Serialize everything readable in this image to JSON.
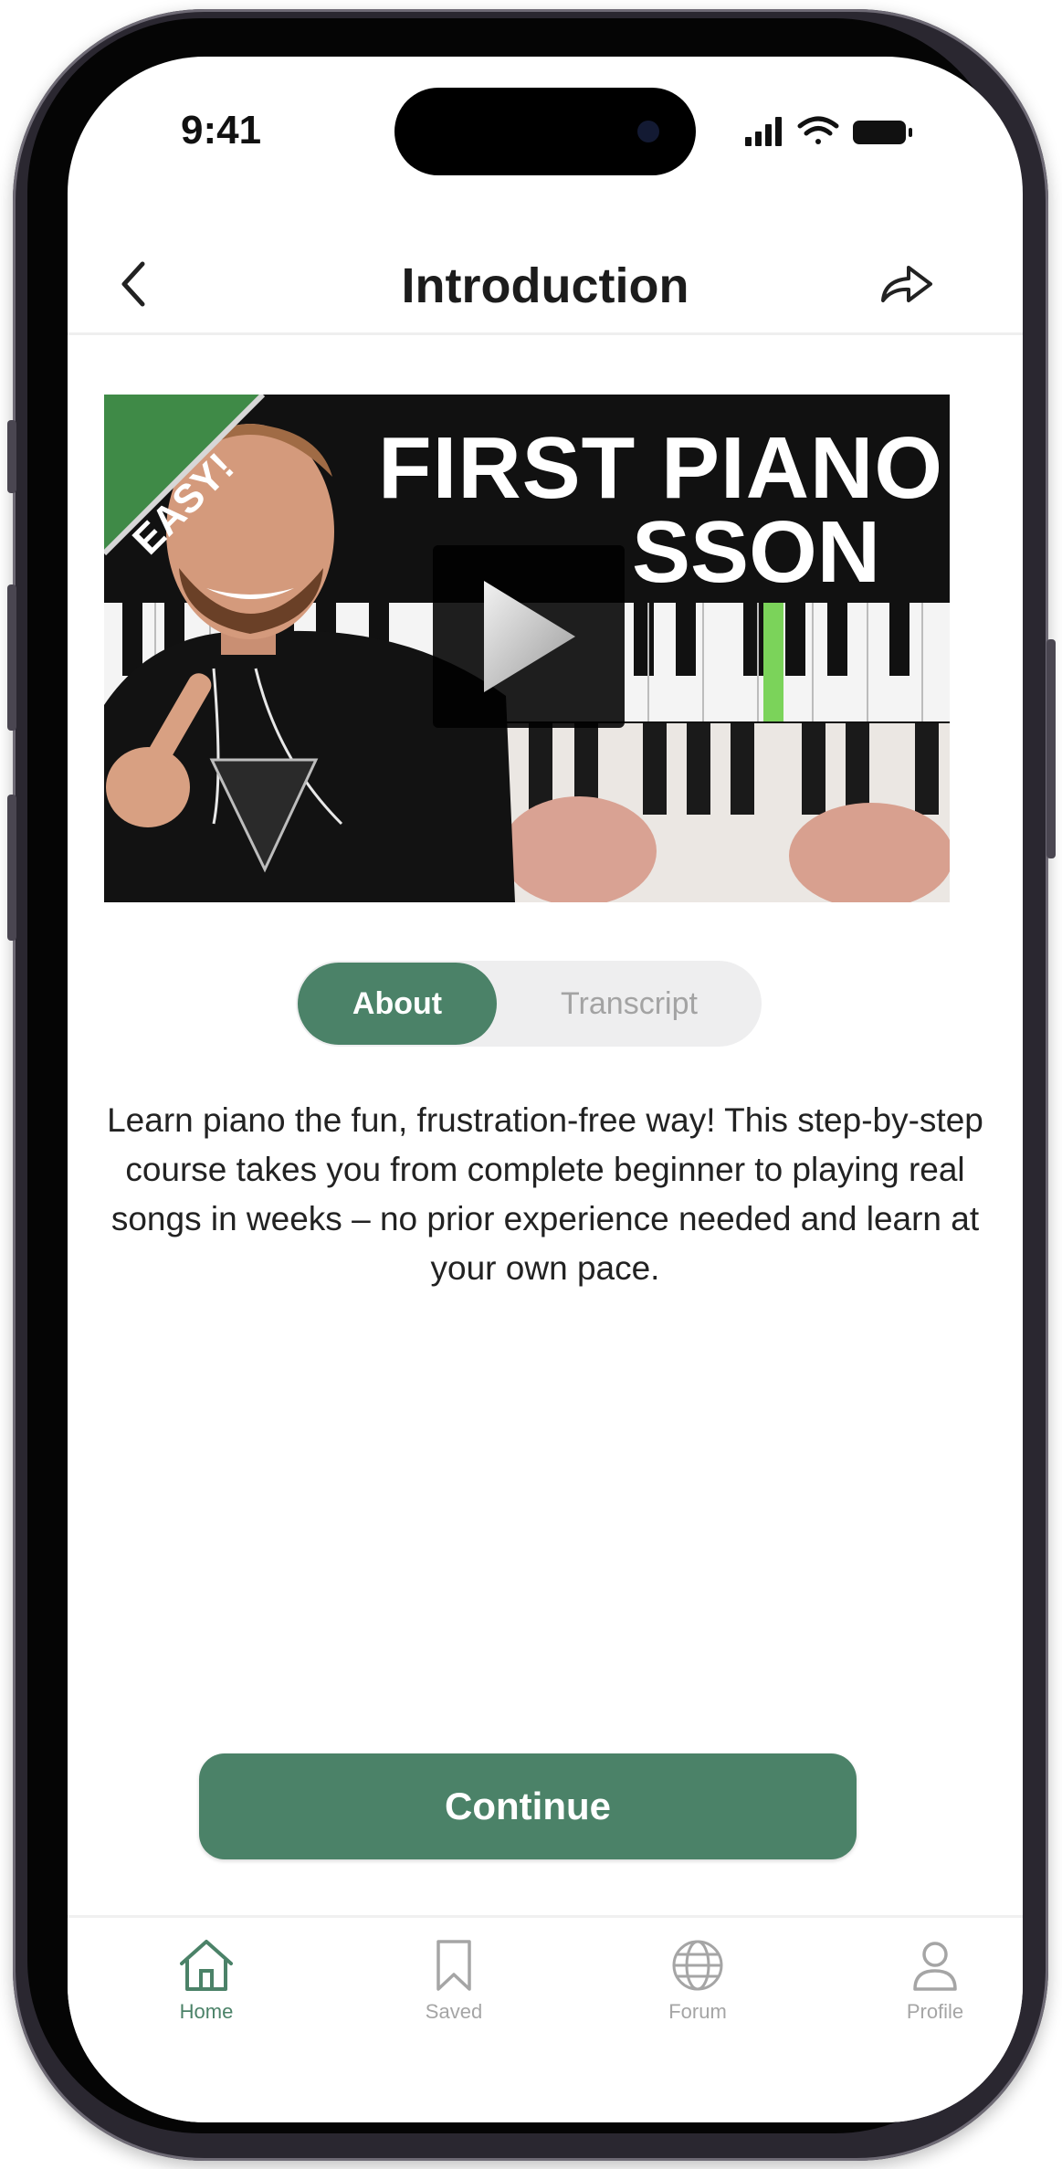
{
  "status_bar": {
    "time": "9:41"
  },
  "header": {
    "title": "Introduction"
  },
  "video": {
    "badge": "EASY!",
    "title_line1": "FIRST PIANO",
    "title_line2": "SSON"
  },
  "tabs": {
    "about": "About",
    "transcript": "Transcript",
    "selected": "About"
  },
  "description": "Learn piano the fun, frustration-free way! This step-by-step course takes you from complete beginner to playing real songs in weeks – no prior experience needed and learn at your own pace.",
  "continue_label": "Continue",
  "nav": [
    {
      "label": "Home",
      "icon": "home-icon",
      "active": true
    },
    {
      "label": "Saved",
      "icon": "bookmark-icon",
      "active": false
    },
    {
      "label": "Forum",
      "icon": "globe-icon",
      "active": false
    },
    {
      "label": "Profile",
      "icon": "person-icon",
      "active": false
    }
  ],
  "colors": {
    "accent": "#4b8268",
    "badge_green": "#3f8a47",
    "inactive": "#a5a5a5"
  }
}
